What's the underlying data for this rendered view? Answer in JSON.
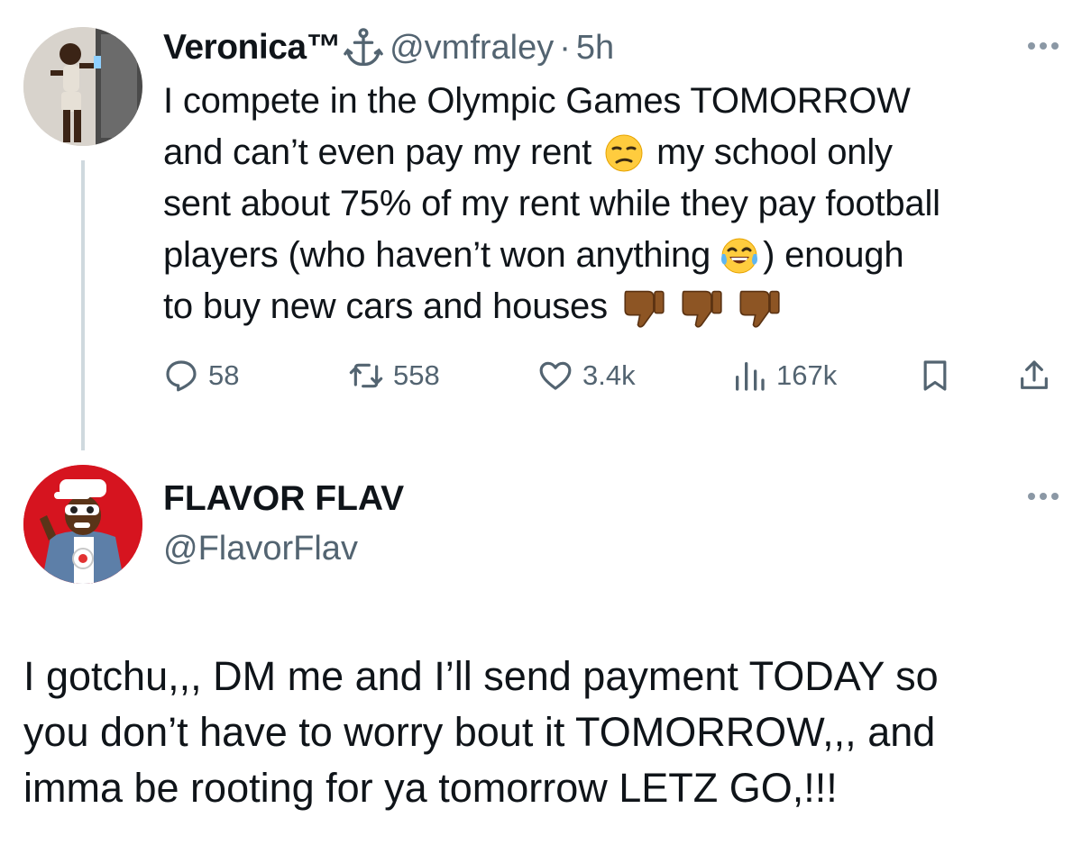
{
  "tweet1": {
    "display_name": "Veronica™",
    "verified_icon": "anchor-icon",
    "handle": "@vmfraley",
    "separator": "·",
    "time": "5h",
    "text_lines": [
      "I compete in the Olympic Games TOMORROW",
      "and can’t even pay my rent",
      "my school only",
      "sent about 75% of my rent while they pay football",
      "players (who haven’t won anything",
      ") enough",
      "to buy new cars and houses"
    ],
    "stats": {
      "replies": "58",
      "reposts": "558",
      "likes": "3.4k",
      "views": "167k"
    }
  },
  "tweet2": {
    "display_name": "FLAVOR FLAV",
    "handle": "@FlavorFlav",
    "text_lines": [
      "I gotchu,,, DM me and I’ll send payment TODAY so",
      "you don’t have to worry bout it TOMORROW,,, and",
      "imma be rooting for ya tomorrow LETZ GO,!!!"
    ]
  },
  "colors": {
    "text": "#0f1419",
    "secondary": "#536471",
    "thread_line": "#cfd9de"
  }
}
